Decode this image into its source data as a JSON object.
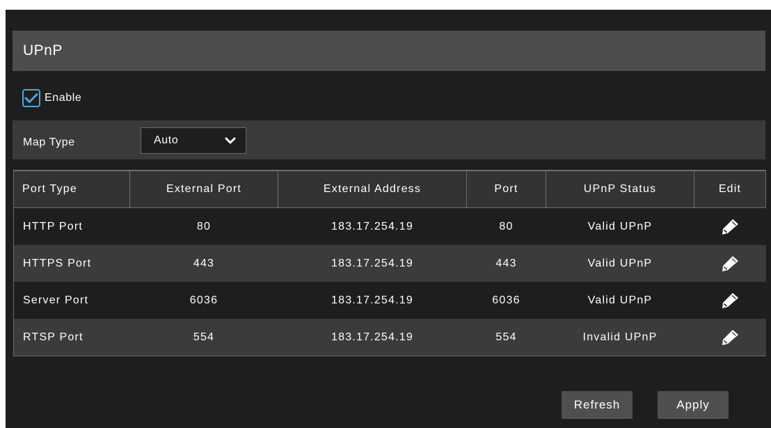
{
  "panel": {
    "title": "UPnP"
  },
  "enable": {
    "label": "Enable",
    "checked": true
  },
  "map_type": {
    "label": "Map Type",
    "value": "Auto"
  },
  "table": {
    "headers": [
      "Port Type",
      "External Port",
      "External Address",
      "Port",
      "UPnP Status",
      "Edit"
    ],
    "rows": [
      {
        "port_type": "HTTP Port",
        "external_port": "80",
        "external_address": "183.17.254.19",
        "port": "80",
        "status": "Valid UPnP"
      },
      {
        "port_type": "HTTPS Port",
        "external_port": "443",
        "external_address": "183.17.254.19",
        "port": "443",
        "status": "Valid UPnP"
      },
      {
        "port_type": "Server Port",
        "external_port": "6036",
        "external_address": "183.17.254.19",
        "port": "6036",
        "status": "Valid UPnP"
      },
      {
        "port_type": "RTSP Port",
        "external_port": "554",
        "external_address": "183.17.254.19",
        "port": "554",
        "status": "Invalid UPnP"
      }
    ]
  },
  "buttons": {
    "refresh": "Refresh",
    "apply": "Apply"
  },
  "icons": {
    "checkbox": "check-icon",
    "dropdown": "chevron-down-icon",
    "edit": "pencil-icon"
  },
  "colors": {
    "accent": "#4aa6e8",
    "background": "#1e1e1c",
    "panel": "#4d4d4d"
  }
}
